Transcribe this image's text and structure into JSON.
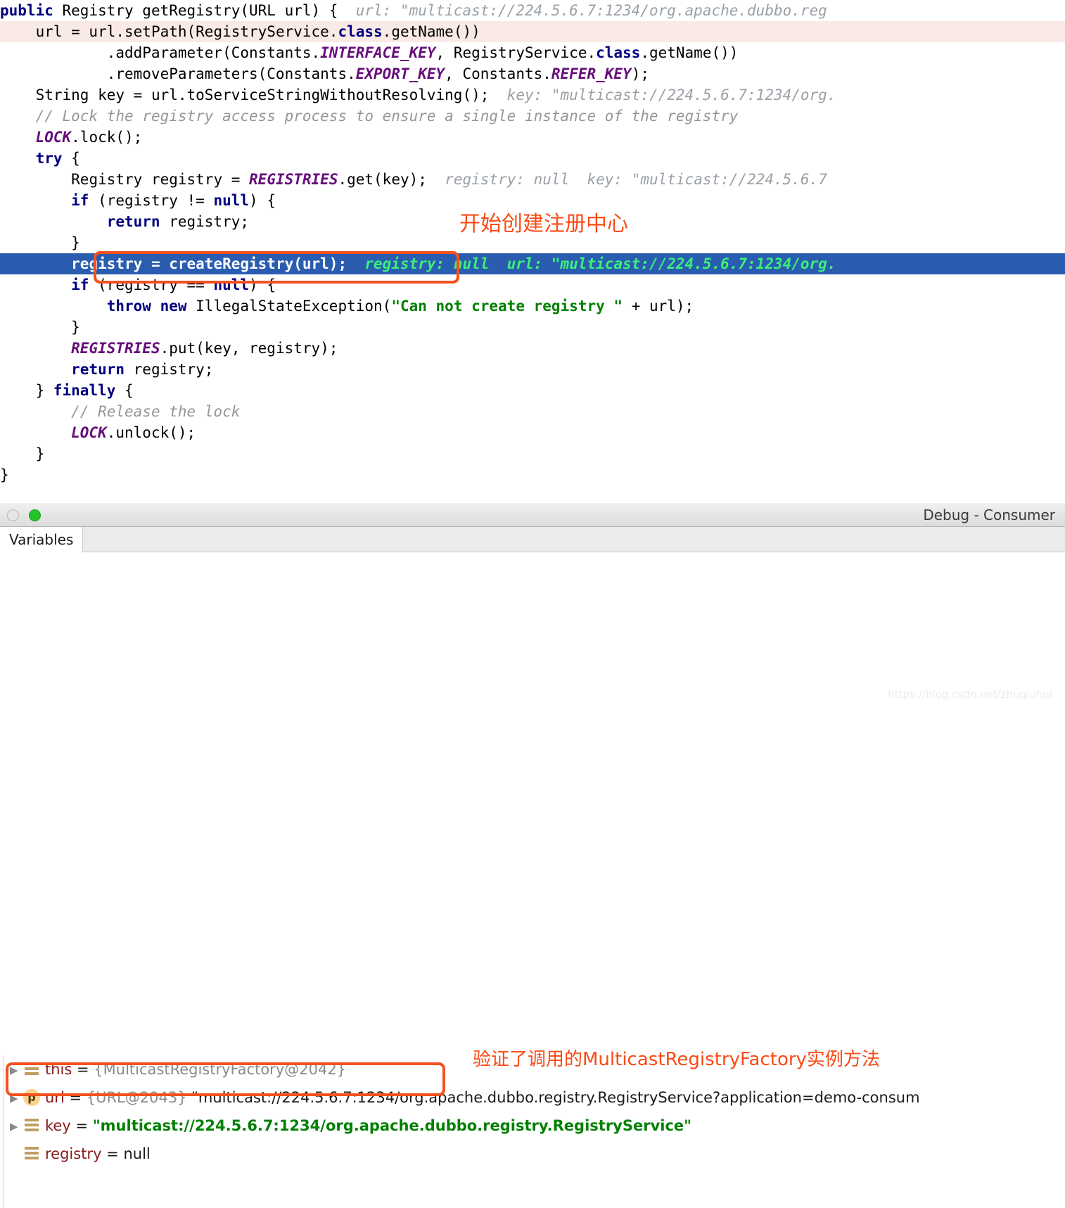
{
  "editor": {
    "lines": [
      {
        "indent": 0,
        "caret": false,
        "selected": false,
        "segments": [
          {
            "t": "kw",
            "s": "public "
          },
          {
            "t": "plain",
            "s": "Registry getRegistry(URL url) { "
          },
          {
            "t": "hint",
            "s": " url: \"multicast://224.5.6.7:1234/org.apache.dubbo.reg"
          }
        ]
      },
      {
        "indent": 1,
        "caret": true,
        "selected": false,
        "segments": [
          {
            "t": "plain",
            "s": "url = url.setPath(RegistryService."
          },
          {
            "t": "kw",
            "s": "class"
          },
          {
            "t": "plain",
            "s": ".getName())"
          }
        ]
      },
      {
        "indent": 3,
        "caret": false,
        "selected": false,
        "segments": [
          {
            "t": "plain",
            "s": ".addParameter(Constants."
          },
          {
            "t": "field",
            "s": "INTERFACE_KEY"
          },
          {
            "t": "plain",
            "s": ", RegistryService."
          },
          {
            "t": "kw",
            "s": "class"
          },
          {
            "t": "plain",
            "s": ".getName())"
          }
        ]
      },
      {
        "indent": 3,
        "caret": false,
        "selected": false,
        "segments": [
          {
            "t": "plain",
            "s": ".removeParameters(Constants."
          },
          {
            "t": "field",
            "s": "EXPORT_KEY"
          },
          {
            "t": "plain",
            "s": ", Constants."
          },
          {
            "t": "field",
            "s": "REFER_KEY"
          },
          {
            "t": "plain",
            "s": ");"
          }
        ]
      },
      {
        "indent": 1,
        "caret": false,
        "selected": false,
        "segments": [
          {
            "t": "plain",
            "s": "String key = url.toServiceStringWithoutResolving(); "
          },
          {
            "t": "hint",
            "s": " key: \"multicast://224.5.6.7:1234/org."
          }
        ]
      },
      {
        "indent": 1,
        "caret": false,
        "selected": false,
        "segments": [
          {
            "t": "cmt",
            "s": "// Lock the registry access process to ensure a single instance of the registry"
          }
        ]
      },
      {
        "indent": 1,
        "caret": false,
        "selected": false,
        "segments": [
          {
            "t": "field",
            "s": "LOCK"
          },
          {
            "t": "plain",
            "s": ".lock();"
          }
        ]
      },
      {
        "indent": 1,
        "caret": false,
        "selected": false,
        "segments": [
          {
            "t": "kw",
            "s": "try"
          },
          {
            "t": "plain",
            "s": " {"
          }
        ]
      },
      {
        "indent": 2,
        "caret": false,
        "selected": false,
        "segments": [
          {
            "t": "plain",
            "s": "Registry registry = "
          },
          {
            "t": "field",
            "s": "REGISTRIES"
          },
          {
            "t": "plain",
            "s": ".get(key); "
          },
          {
            "t": "hint",
            "s": " registry: null  key: \"multicast://224.5.6.7"
          }
        ]
      },
      {
        "indent": 2,
        "caret": false,
        "selected": false,
        "segments": [
          {
            "t": "kw",
            "s": "if"
          },
          {
            "t": "plain",
            "s": " (registry != "
          },
          {
            "t": "kw",
            "s": "null"
          },
          {
            "t": "plain",
            "s": ") {"
          }
        ]
      },
      {
        "indent": 3,
        "caret": false,
        "selected": false,
        "segments": [
          {
            "t": "kw",
            "s": "return"
          },
          {
            "t": "plain",
            "s": " registry;"
          }
        ]
      },
      {
        "indent": 2,
        "caret": false,
        "selected": false,
        "segments": [
          {
            "t": "plain",
            "s": "}"
          }
        ]
      },
      {
        "indent": 2,
        "caret": false,
        "selected": true,
        "segments": [
          {
            "t": "plain",
            "s": "registry = createRegistry(url);"
          },
          {
            "t": "hint-green",
            "s": "  registry: null  url: \"multicast://224.5.6.7:1234/org."
          }
        ]
      },
      {
        "indent": 2,
        "caret": false,
        "selected": false,
        "segments": [
          {
            "t": "kw",
            "s": "if"
          },
          {
            "t": "plain",
            "s": " (registry == "
          },
          {
            "t": "kw",
            "s": "null"
          },
          {
            "t": "plain",
            "s": ") {"
          }
        ]
      },
      {
        "indent": 3,
        "caret": false,
        "selected": false,
        "segments": [
          {
            "t": "kw",
            "s": "throw new"
          },
          {
            "t": "plain",
            "s": " IllegalStateException("
          },
          {
            "t": "str",
            "s": "\"Can not create registry \""
          },
          {
            "t": "plain",
            "s": " + url);"
          }
        ]
      },
      {
        "indent": 2,
        "caret": false,
        "selected": false,
        "segments": [
          {
            "t": "plain",
            "s": "}"
          }
        ]
      },
      {
        "indent": 2,
        "caret": false,
        "selected": false,
        "segments": [
          {
            "t": "field",
            "s": "REGISTRIES"
          },
          {
            "t": "plain",
            "s": ".put(key, registry);"
          }
        ]
      },
      {
        "indent": 2,
        "caret": false,
        "selected": false,
        "segments": [
          {
            "t": "kw",
            "s": "return"
          },
          {
            "t": "plain",
            "s": " registry;"
          }
        ]
      },
      {
        "indent": 1,
        "caret": false,
        "selected": false,
        "segments": [
          {
            "t": "plain",
            "s": "} "
          },
          {
            "t": "kw",
            "s": "finally"
          },
          {
            "t": "plain",
            "s": " {"
          }
        ]
      },
      {
        "indent": 2,
        "caret": false,
        "selected": false,
        "segments": [
          {
            "t": "cmt",
            "s": "// Release the lock"
          }
        ]
      },
      {
        "indent": 2,
        "caret": false,
        "selected": false,
        "segments": [
          {
            "t": "field",
            "s": "LOCK"
          },
          {
            "t": "plain",
            "s": ".unlock();"
          }
        ]
      },
      {
        "indent": 1,
        "caret": false,
        "selected": false,
        "segments": [
          {
            "t": "plain",
            "s": "}"
          }
        ]
      },
      {
        "indent": 0,
        "caret": false,
        "selected": false,
        "segments": [
          {
            "t": "plain",
            "s": "}"
          }
        ]
      }
    ],
    "annotation_create_registry": "开始创建注册中心"
  },
  "debug": {
    "window_title": "Debug - Consumer",
    "stop_button_icon": "stop-circle-icon",
    "run_button_icon": "run-circle-icon",
    "tabs": [
      {
        "label": "Variables",
        "active": true
      }
    ],
    "annotation_verify": "验证了调用的MulticastRegistryFactory实例方法",
    "variables": [
      {
        "expandable": true,
        "icon": "field-icon",
        "icon_letter": "",
        "name": "this",
        "eq": " = ",
        "value": "{MulticastRegistryFactory@2042}",
        "value_style": "ref",
        "highlighted": true
      },
      {
        "expandable": true,
        "icon": "param-icon",
        "icon_letter": "p",
        "name": "url",
        "eq": " = ",
        "value": "{URL@2043} \"multicast://224.5.6.7:1234/org.apache.dubbo.registry.RegistryService?application=demo-consum",
        "value_style": "mixed-ref",
        "highlighted": false
      },
      {
        "expandable": true,
        "icon": "field-icon",
        "icon_letter": "",
        "name": "key",
        "eq": " = ",
        "value": "\"multicast://224.5.6.7:1234/org.apache.dubbo.registry.RegistryService\"",
        "value_style": "str",
        "highlighted": false
      },
      {
        "expandable": false,
        "icon": "field-icon",
        "icon_letter": "",
        "name": "registry",
        "eq": " = ",
        "value": "null",
        "value_style": "plain",
        "highlighted": false
      }
    ]
  },
  "watermark": "https://blog.csdn.net/zhuqiuhui",
  "colors": {
    "keyword": "#000080",
    "field": "#660e7a",
    "string": "#008000",
    "comment": "#969696",
    "hint": "#9aa0a6",
    "selection_bg": "#2a5db0",
    "selection_hint": "#3bf07a",
    "caret_row_bg": "#faeae6",
    "annotation_red": "#fa4b16",
    "var_name": "#871a1a"
  }
}
